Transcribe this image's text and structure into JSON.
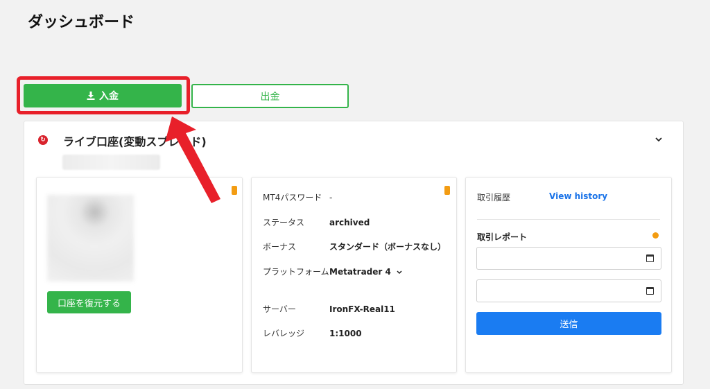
{
  "page_title": "ダッシュボード",
  "actions": {
    "deposit_label": "入金",
    "withdraw_label": "出金"
  },
  "account": {
    "title": "ライブ口座(変動スプレッド)",
    "restore_label": "口座を復元する",
    "details": [
      {
        "label": "MT4パスワード",
        "value": "-"
      },
      {
        "label": "ステータス",
        "value": "archived"
      },
      {
        "label": "ボーナス",
        "value": "スタンダード（ボーナスなし）"
      },
      {
        "label": "プラットフォーム",
        "value": "Metatrader 4"
      },
      {
        "label": "サーバー",
        "value": "IronFX-Real11"
      },
      {
        "label": "レバレッジ",
        "value": "1:1000"
      }
    ]
  },
  "history": {
    "label": "取引履歴",
    "link": "View history"
  },
  "report": {
    "label": "取引レポート",
    "submit_label": "送信"
  },
  "colors": {
    "green": "#34b44a",
    "blue": "#1a7cf2",
    "red": "#e8202a",
    "orange": "#f39c12"
  }
}
